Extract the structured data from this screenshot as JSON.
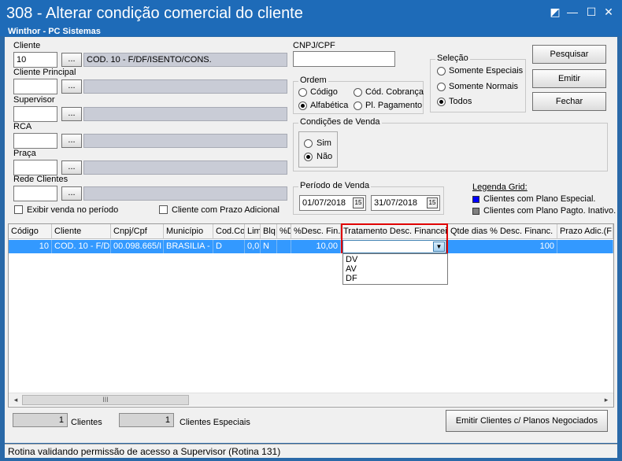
{
  "window": {
    "title": "308 - Alterar condição comercial do cliente",
    "subtitle": "Winthor - PC Sistemas",
    "controls": {
      "restore": "◩",
      "minimize": "—",
      "maximize": "☐",
      "close": "✕"
    }
  },
  "filters": {
    "cliente": {
      "label": "Cliente",
      "code": "10",
      "desc": "COD. 10 - F/DF/ISENTO/CONS."
    },
    "cliente_principal": {
      "label": "Cliente Principal",
      "code": "",
      "desc": ""
    },
    "supervisor": {
      "label": "Supervisor",
      "code": "",
      "desc": ""
    },
    "rca": {
      "label": "RCA",
      "code": "",
      "desc": ""
    },
    "praca": {
      "label": "Praça",
      "code": "",
      "desc": ""
    },
    "rede_clientes": {
      "label": "Rede Clientes",
      "code": "",
      "desc": ""
    },
    "lookup_label": "...",
    "exibir_venda": "Exibir venda no período",
    "prazo_adicional": "Cliente com Prazo Adicional"
  },
  "cnpj": {
    "label": "CNPJ/CPF",
    "value": ""
  },
  "ordem": {
    "title": "Ordem",
    "options": [
      "Código",
      "Cód. Cobrança",
      "Alfabética",
      "Pl. Pagamento"
    ],
    "selected": "Alfabética"
  },
  "selecao": {
    "title": "Seleção",
    "options": [
      "Somente Especiais",
      "Somente Normais",
      "Todos"
    ],
    "selected": "Todos"
  },
  "condicoes_venda": {
    "title": "Condições de Venda",
    "options": [
      "Sim",
      "Não"
    ],
    "selected": "Não"
  },
  "periodo_venda": {
    "title": "Período de Venda",
    "start": "01/07/2018",
    "end": "31/07/2018",
    "cal_icon": "15"
  },
  "legenda": {
    "title": "Legenda Grid:",
    "items": [
      {
        "label": "Clientes com Plano Especial.",
        "color": "#0000ff"
      },
      {
        "label": "Clientes com Plano Pagto. Inativo.",
        "color": "#808080"
      }
    ]
  },
  "buttons": {
    "pesquisar": "Pesquisar",
    "emitir": "Emitir",
    "fechar": "Fechar",
    "emitir_clientes": "Emitir Clientes c/ Planos Negociados"
  },
  "grid": {
    "columns": [
      "Código",
      "Cliente",
      "Cnpj/Cpf",
      "Município",
      "Cod.Co",
      "Lim",
      "Blq",
      "%D",
      "%Desc. Fin.",
      "Tratamento Desc. Financeir",
      "Qtde dias % Desc. Financ.",
      "Prazo Adic.(F"
    ],
    "rows": [
      [
        "10",
        "COD. 10 - F/DF",
        "00.098.665/I",
        "BRASILIA - I",
        "D",
        "0,0",
        "N",
        "",
        "10,00",
        "",
        "100",
        ""
      ]
    ],
    "dropdown_options": [
      "DV",
      "AV",
      "DF"
    ],
    "scroll_thumb": "III",
    "scroll_left": "◂",
    "scroll_right": "▸",
    "combo_arrow": "▼"
  },
  "counters": {
    "clientes": {
      "value": "1",
      "label": "Clientes"
    },
    "especiais": {
      "value": "1",
      "label": "Clientes Especiais"
    }
  },
  "status_text": "Rotina validando permissão de acesso a Supervisor (Rotina 131)"
}
